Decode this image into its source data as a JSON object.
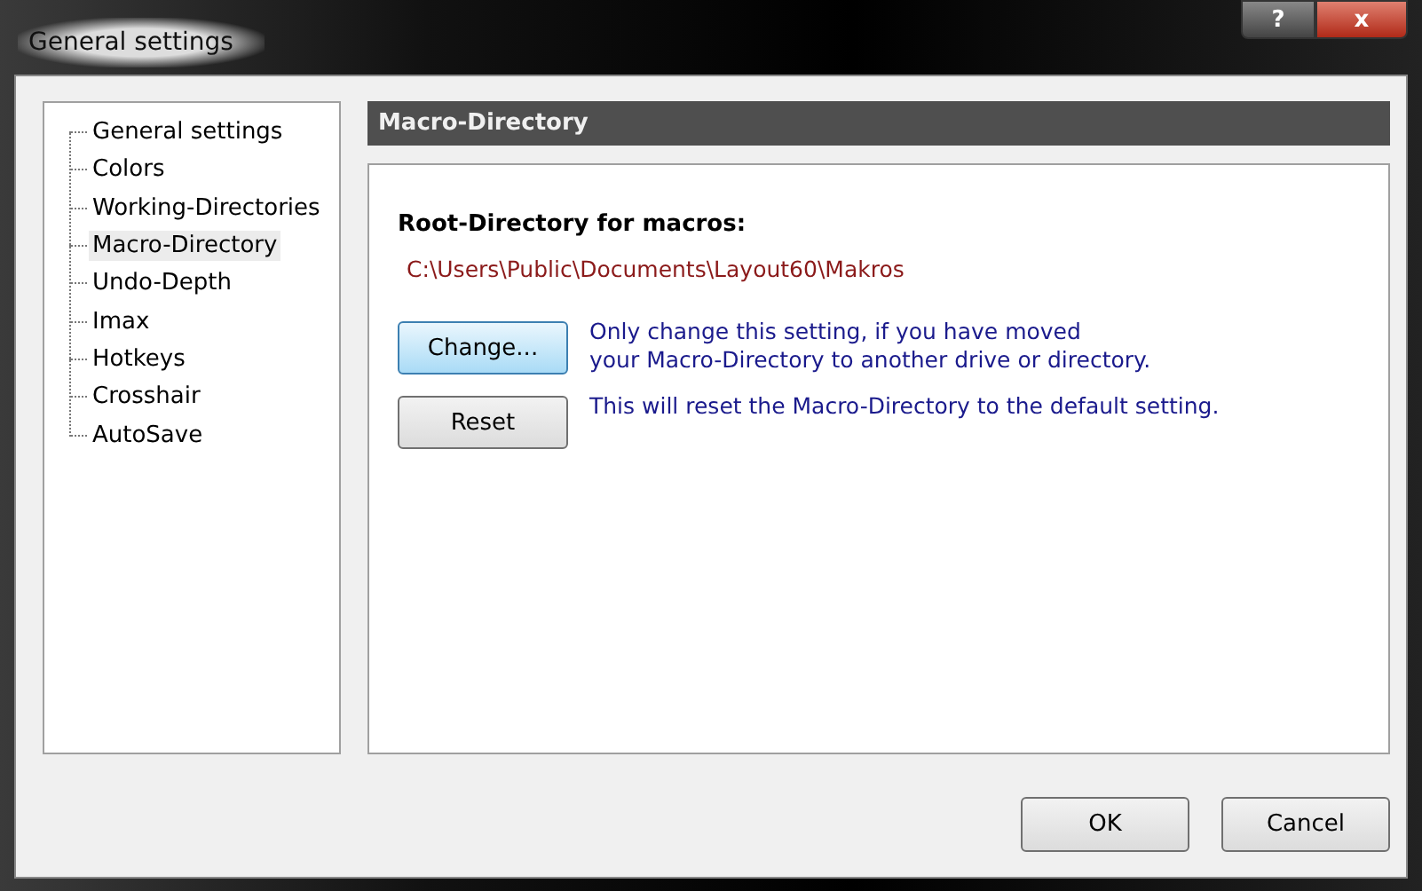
{
  "window": {
    "title": "General settings",
    "controls": [
      {
        "kind": "help",
        "label": "?"
      },
      {
        "kind": "close",
        "label": "x"
      }
    ]
  },
  "tree": {
    "items": [
      {
        "label": "General settings",
        "selected": false
      },
      {
        "label": "Colors",
        "selected": false
      },
      {
        "label": "Working-Directories",
        "selected": false
      },
      {
        "label": "Macro-Directory",
        "selected": true
      },
      {
        "label": "Undo-Depth",
        "selected": false
      },
      {
        "label": "Imax",
        "selected": false
      },
      {
        "label": "Hotkeys",
        "selected": false
      },
      {
        "label": "Crosshair",
        "selected": false
      },
      {
        "label": "AutoSave",
        "selected": false
      }
    ]
  },
  "panel": {
    "title": "Macro-Directory",
    "heading": "Root-Directory for macros:",
    "path": "C:\\Users\\Public\\Documents\\Layout60\\Makros",
    "actions": [
      {
        "button": "Change...",
        "focused": true,
        "hint": [
          "Only change this setting, if you have moved",
          "your Macro-Directory to another drive or directory."
        ]
      },
      {
        "button": "Reset",
        "focused": false,
        "hint": [
          "This will reset the Macro-Directory to the default setting."
        ]
      }
    ]
  },
  "buttons": [
    "OK",
    "Cancel"
  ]
}
